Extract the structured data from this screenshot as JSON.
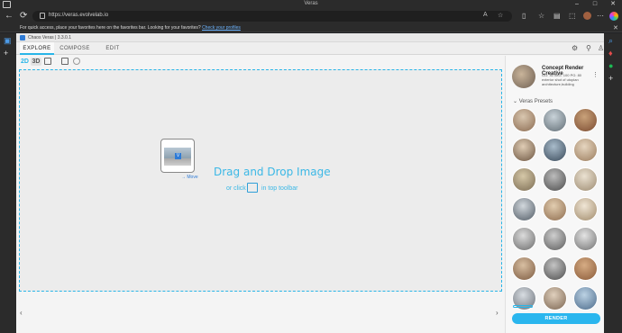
{
  "browser": {
    "window_title": "Veras",
    "url": "https://veras.evolvelab.io",
    "favorites_message": "For quick access, place your favorites here on the favorites bar. Looking for your favorites?",
    "favorites_link": "Check your profiles",
    "close_glyph": "✕"
  },
  "app": {
    "title": "Chaos Veras | 3.3.0.1",
    "tabs": [
      {
        "label": "EXPLORE",
        "active": true
      },
      {
        "label": "COMPOSE",
        "active": false
      },
      {
        "label": "EDIT",
        "active": false
      }
    ],
    "view_toggle": {
      "label_2d": "2D",
      "label_3d": "3D"
    },
    "dropzone": {
      "title": "Drag and Drop Image",
      "sub_prefix": "or click",
      "sub_suffix": "in top toolbar",
      "move_label": "Move"
    },
    "prev_arrow": "‹",
    "next_arrow": "›"
  },
  "panel": {
    "style_name": "Concept Render Creative",
    "style_desc": "GG: 40 IMG: 100 PG: 80 exterior shot of utopian architecture,building",
    "presets_label": "Veras Presets",
    "render_label": "RENDER"
  },
  "colors": {
    "accent": "#28b5e8",
    "render_button": "#2ab6ee"
  }
}
